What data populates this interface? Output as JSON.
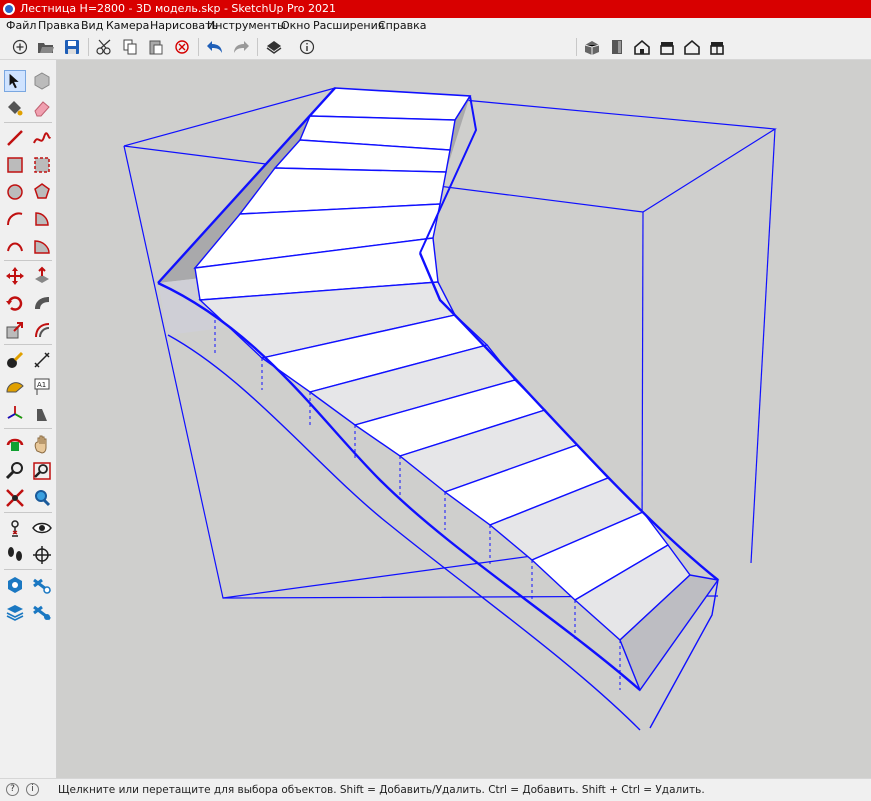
{
  "window": {
    "title": "Лестница H=2800 - 3D модель.skp - SketchUp Pro 2021"
  },
  "menu": [
    {
      "label": "Файл"
    },
    {
      "label": "Правка"
    },
    {
      "label": "Вид"
    },
    {
      "label": "Камера"
    },
    {
      "label": "Нарисовать"
    },
    {
      "label": "Инструменты"
    },
    {
      "label": "Окно"
    },
    {
      "label": "Расширения"
    },
    {
      "label": "Справка"
    }
  ],
  "toolbar": {
    "left_icons": [
      "new-icon",
      "open-icon",
      "save-icon",
      "cut-icon",
      "copy-icon",
      "paste-icon",
      "erase-icon",
      "undo-icon",
      "redo-icon",
      "print-icon",
      "model-info-icon"
    ],
    "view_icons": [
      "iso-view-icon",
      "top-view-icon",
      "front-view-icon",
      "right-view-icon",
      "back-view-icon",
      "left-view-icon"
    ]
  },
  "tools": [
    [
      "select-icon",
      "component-icon"
    ],
    [
      "paint-bucket-icon",
      "eraser-icon"
    ],
    [
      "line-icon",
      "freehand-icon"
    ],
    [
      "rectangle-icon",
      "rotated-rectangle-icon"
    ],
    [
      "circle-icon",
      "polygon-icon"
    ],
    [
      "arc-icon",
      "pie-icon"
    ],
    [
      "three-point-arc-icon",
      "two-point-arc-icon"
    ],
    [
      "move-icon",
      "push-pull-icon"
    ],
    [
      "rotate-icon",
      "follow-me-icon"
    ],
    [
      "scale-icon",
      "offset-icon"
    ],
    [
      "tape-measure-icon",
      "dimension-icon"
    ],
    [
      "protractor-icon",
      "text-icon"
    ],
    [
      "axes-icon",
      "3d-text-icon"
    ],
    [
      "orbit-icon",
      "pan-icon"
    ],
    [
      "zoom-icon",
      "zoom-window-icon"
    ],
    [
      "zoom-extents-icon",
      "previous-view-icon"
    ],
    [
      "position-camera-icon",
      "look-around-icon"
    ],
    [
      "walk-icon",
      "section-plane-icon"
    ],
    [
      "warehouse-icon",
      "extension-icon"
    ],
    [
      "layers-icon",
      "extension-manager-icon"
    ]
  ],
  "status": {
    "text": "Щелкните или перетащите для выбора объектов. Shift = Добавить/Удалить. Ctrl = Добавить. Shift + Ctrl = Удалить."
  },
  "colors": {
    "titlebar": "#d80000",
    "viewport_bg": "#cfcfcd",
    "selection": "#1010ff"
  }
}
